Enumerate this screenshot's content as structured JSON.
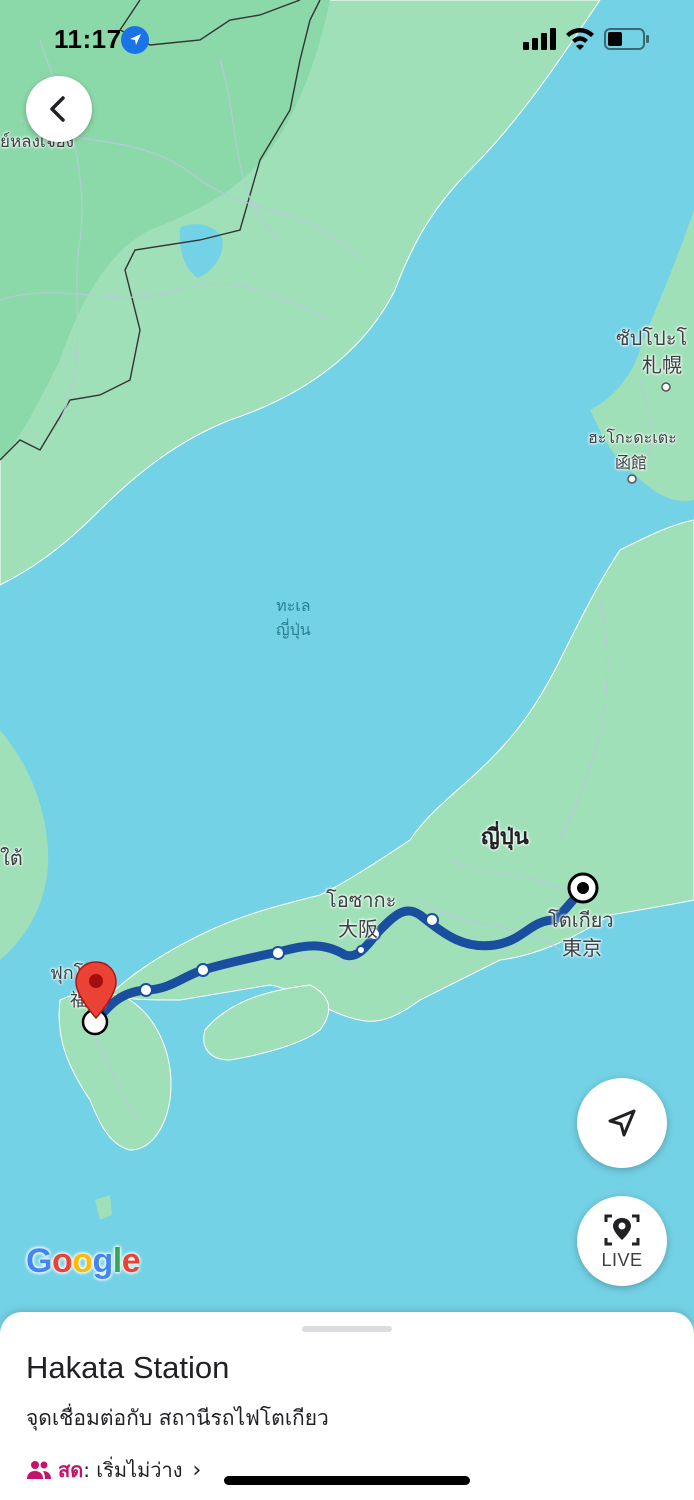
{
  "status_bar": {
    "time": "11:17"
  },
  "map": {
    "labels": {
      "korea_fragment": "ย์หลงเจียง",
      "sapporo_th": "ซัปโปะโ",
      "sapporo_jp": "札幌",
      "hakodate_th": "ฮะโกะดะเตะ",
      "hakodate_jp": "函館",
      "sea_line1": "ทะเล",
      "sea_line2": "ญี่ปุ่น",
      "japan": "ญี่ปุ่น",
      "osaka_th": "โอซากะ",
      "osaka_jp": "大阪",
      "tokyo_th": "โตเกียว",
      "tokyo_jp": "東京",
      "fukuoka_th": "ฟุกโอกะ",
      "fukuoka_jp": "福岡",
      "left_fragment": "ใต้"
    },
    "route_color": "#1a4fa0",
    "destination_pin_color": "#ea4335"
  },
  "controls": {
    "live_label": "LIVE"
  },
  "google_logo": {
    "letters": [
      "G",
      "o",
      "o",
      "g",
      "l",
      "e"
    ],
    "colors": [
      "#4285f4",
      "#ea4335",
      "#fbbc05",
      "#4285f4",
      "#34a853",
      "#ea4335"
    ]
  },
  "sheet": {
    "title": "Hakata Station",
    "subtitle": "จุดเชื่อมต่อกับ สถานีรถไฟโตเกียว",
    "live_prefix": "สด",
    "live_status": ": เริ่มไม่ว่าง"
  }
}
